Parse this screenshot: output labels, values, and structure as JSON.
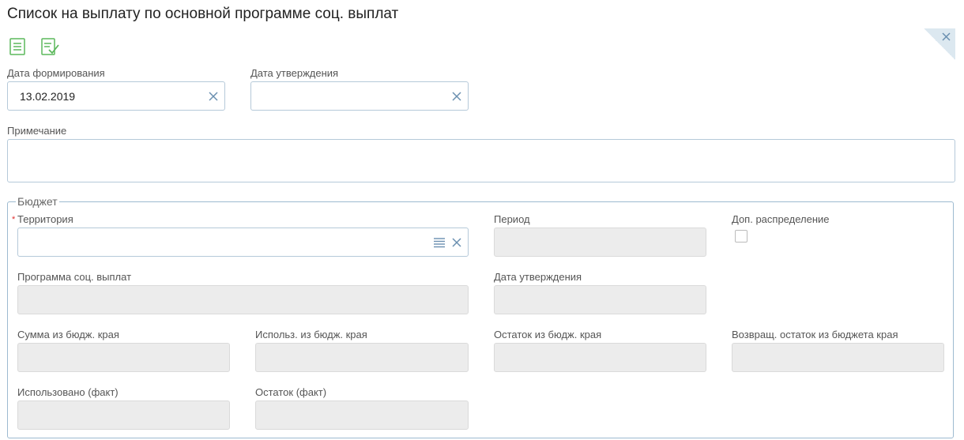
{
  "page": {
    "title": "Список на выплату по основной программе соц. выплат"
  },
  "toolbar": {
    "icons": [
      "save-icon",
      "save-approve-icon"
    ]
  },
  "form": {
    "date_formed": {
      "label": "Дата формирования",
      "value": "13.02.2019"
    },
    "date_approved": {
      "label": "Дата утверждения",
      "value": ""
    },
    "note": {
      "label": "Примечание",
      "value": ""
    }
  },
  "budget": {
    "legend": "Бюджет",
    "territory": {
      "label": "Территория",
      "required_mark": "*",
      "value": ""
    },
    "period": {
      "label": "Период",
      "value": ""
    },
    "extra_distribution": {
      "label": "Доп. распределение",
      "checked": false
    },
    "program": {
      "label": "Программа соц. выплат",
      "value": ""
    },
    "approval_date": {
      "label": "Дата утверждения",
      "value": ""
    },
    "sum_region": {
      "label": "Сумма из бюдж. края",
      "value": ""
    },
    "used_region": {
      "label": "Использ. из бюдж. края",
      "value": ""
    },
    "remainder_region": {
      "label": "Остаток из бюдж. края",
      "value": ""
    },
    "returned_remainder": {
      "label": "Возвращ. остаток из бюджета края",
      "value": ""
    },
    "used_fact": {
      "label": "Использовано (факт)",
      "value": ""
    },
    "remainder_fact": {
      "label": "Остаток (факт)",
      "value": ""
    }
  },
  "colors": {
    "accent_green": "#5cb85c",
    "border_blue": "#b5c9d9",
    "disabled_bg": "#ececec",
    "required_red": "#e03030"
  }
}
